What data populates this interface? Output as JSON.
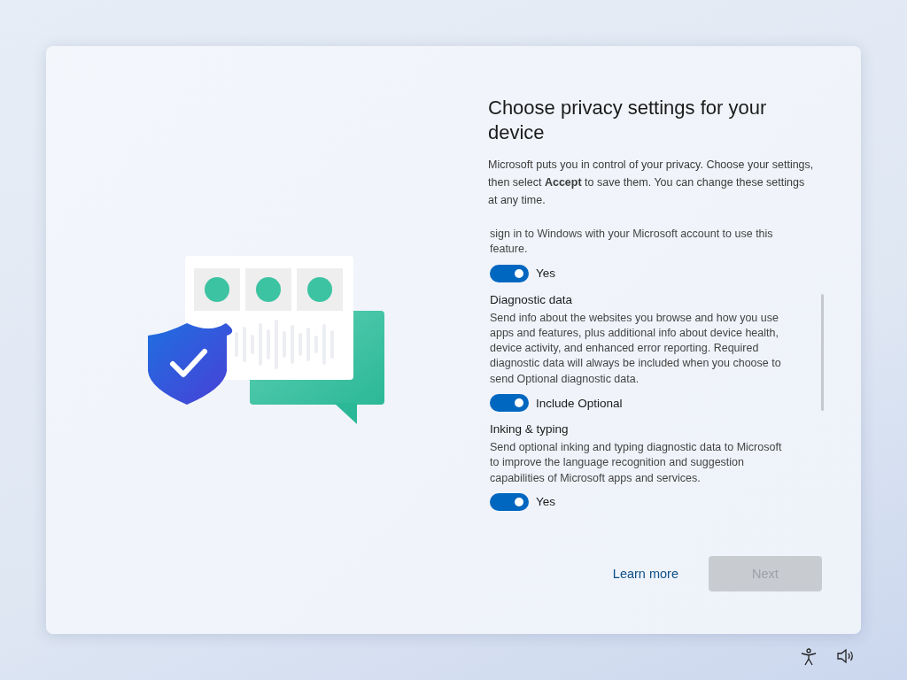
{
  "dialog": {
    "title": "Choose privacy settings for your device",
    "intro": "Microsoft puts you in control of your privacy. Choose your settings, then select **Accept** to save them. You can change these settings at any time.",
    "settings": [
      {
        "description": "sign in to Windows with your Microsoft account to use this feature.",
        "on": true,
        "toggle_label": "Yes"
      },
      {
        "title": "Diagnostic data",
        "description": "Send info about the websites you browse and how you use apps and features, plus additional info about device health, device activity, and enhanced error reporting. Required diagnostic data will always be included when you choose to send Optional diagnostic data.",
        "on": true,
        "toggle_label": "Include Optional"
      },
      {
        "title": "Inking & typing",
        "description": "Send optional inking and typing diagnostic data to Microsoft to improve the language recognition and suggestion capabilities of Microsoft apps and services.",
        "on": true,
        "toggle_label": "Yes"
      }
    ],
    "learn_more": "Learn more",
    "next_button": {
      "label": "Next",
      "disabled": true
    }
  }
}
